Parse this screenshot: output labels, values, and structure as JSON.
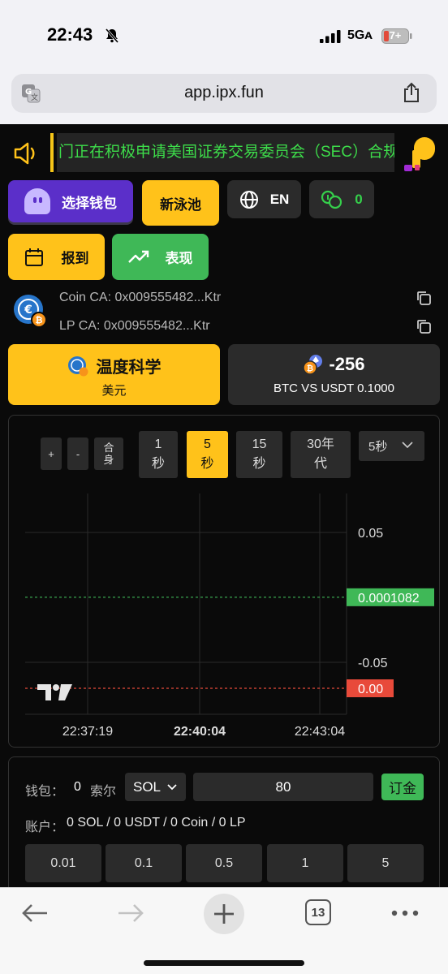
{
  "status_bar": {
    "time": "22:43",
    "network": "5Gᴀ",
    "battery": "7+"
  },
  "browser": {
    "url": "app.ipx.fun",
    "tabs_count": "13"
  },
  "marquee": {
    "text": "门正在积极申请美国证券交易委员会（SEC）合规批"
  },
  "toolbar": {
    "wallet_label": "选择钱包",
    "pool_label": "新泳池",
    "lang_label": "EN",
    "coin_count": "0",
    "checkin_label": "报到",
    "performance_label": "表现"
  },
  "contract": {
    "coin_ca_label": "Coin CA:",
    "coin_ca_value": "0x009555482...Ktr",
    "lp_ca_label": "LP CA:",
    "lp_ca_value": "0x009555482...Ktr"
  },
  "token_card": {
    "name": "温度科学",
    "unit": "美元"
  },
  "pair_card": {
    "value": "-256",
    "pair": "BTC VS USDT 0.1000"
  },
  "chart_controls": {
    "zoom_in": "+",
    "zoom_out": "-",
    "fit": "合身",
    "intervals": [
      {
        "label": "1秒",
        "active": false
      },
      {
        "label": "5秒",
        "active": true
      },
      {
        "label": "15秒",
        "active": false
      },
      {
        "label": "30年代",
        "active": false
      }
    ],
    "selected_interval": "5秒"
  },
  "chart_data": {
    "type": "line",
    "x_ticks": [
      "22:37:19",
      "22:40:04",
      "22:43:04"
    ],
    "x_tick_bold": [
      false,
      true,
      false
    ],
    "y_ticks": [
      0.05,
      -0.05
    ],
    "y_tick_labels": [
      "0.05",
      "-0.05"
    ],
    "ylim": [
      -0.09,
      0.08
    ],
    "price_lines": [
      {
        "value": 0.0001082,
        "label": "0.0001082",
        "color": "#3fb857"
      },
      {
        "value": -0.07,
        "label": "0.00",
        "color": "#e84a3a"
      }
    ],
    "grid": true,
    "watermark": "TV"
  },
  "trade": {
    "wallet_label": "钱包：",
    "wallet_amount": "0",
    "wallet_unit": "索尔",
    "currency": "SOL",
    "amount": "80",
    "order_label": "订金",
    "account_label": "账户：",
    "account_value": "0 SOL / 0 USDT / 0 Coin / 0 LP",
    "quick_amounts": [
      "0.01",
      "0.1",
      "0.5",
      "1",
      "5"
    ]
  },
  "colors": {
    "accent_yellow": "#ffc21a",
    "accent_green": "#3fb857",
    "accent_purple": "#5b2fc9",
    "accent_red": "#e84a3a"
  }
}
